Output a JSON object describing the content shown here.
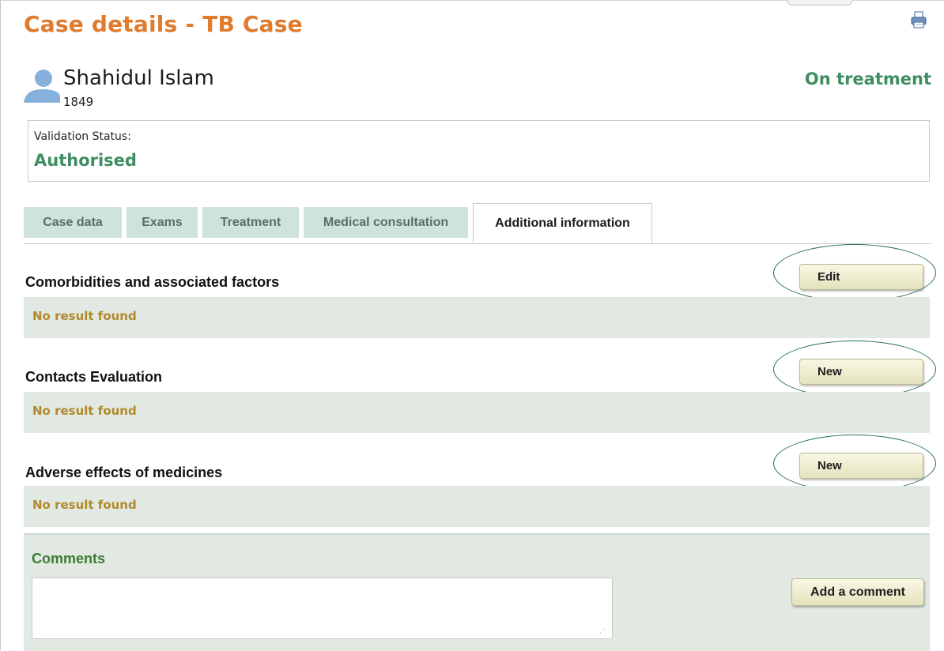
{
  "header": {
    "title": "Case details - TB Case",
    "print_icon": "printer-icon"
  },
  "patient": {
    "name": "Shahidul Islam",
    "id": "1849",
    "avatar_icon": "user-icon",
    "state": "On treatment"
  },
  "validation": {
    "label": "Validation Status:",
    "value": "Authorised"
  },
  "tabs": [
    {
      "label": "Case data",
      "active": false
    },
    {
      "label": "Exams",
      "active": false
    },
    {
      "label": "Treatment",
      "active": false
    },
    {
      "label": "Medical consultation",
      "active": false
    },
    {
      "label": "Additional information",
      "active": true
    }
  ],
  "sections": [
    {
      "title": "Comorbidities and associated factors",
      "button_label": "Edit",
      "empty_text": "No result found"
    },
    {
      "title": "Contacts Evaluation",
      "button_label": "New",
      "empty_text": "No result found"
    },
    {
      "title": "Adverse effects of medicines",
      "button_label": "New",
      "empty_text": "No result found"
    }
  ],
  "comments": {
    "title": "Comments",
    "value": "",
    "button_label": "Add a comment"
  },
  "colors": {
    "title_orange": "#e07a2c",
    "status_green": "#3e8e62",
    "panel_bg": "#e1e9e2",
    "tab_bg": "#cfe3da",
    "empty_text": "#b18a2c",
    "annotation_circle": "#2a6e62"
  }
}
